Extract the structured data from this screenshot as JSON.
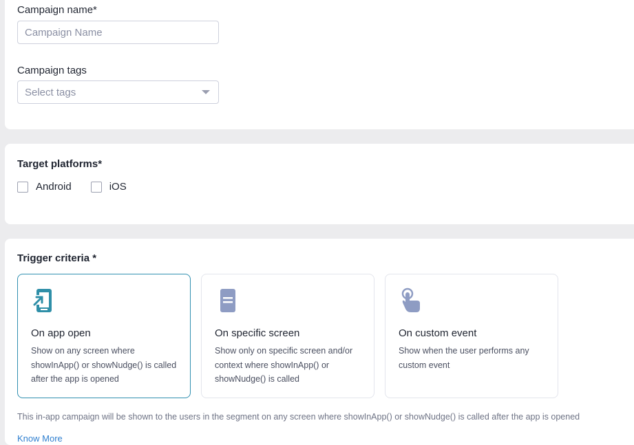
{
  "campaign_name": {
    "label": "Campaign name*",
    "placeholder": "Campaign Name",
    "value": ""
  },
  "campaign_tags": {
    "label": "Campaign tags",
    "placeholder": "Select tags"
  },
  "platforms": {
    "label": "Target platforms*",
    "options": [
      {
        "label": "Android",
        "checked": false
      },
      {
        "label": "iOS",
        "checked": false
      }
    ]
  },
  "trigger": {
    "label": "Trigger criteria *",
    "options": [
      {
        "title": "On app open",
        "description": "Show on any screen where showInApp() or showNudge() is called after the app is opened",
        "icon": "app-open-icon",
        "selected": true,
        "icon_color": "#2f8fa8"
      },
      {
        "title": "On specific screen",
        "description": "Show only on specific screen and/or context where showInApp() or showNudge() is called",
        "icon": "screen-icon",
        "selected": false,
        "icon_color": "#8e9cc3"
      },
      {
        "title": "On custom event",
        "description": "Show when the user performs any custom event",
        "icon": "tap-icon",
        "selected": false,
        "icon_color": "#8e9cc3"
      }
    ],
    "note": "This in-app campaign will be shown to the users in the segment on any screen where showInApp() or showNudge() is called after the app is opened",
    "link": "Know More"
  },
  "colors": {
    "selected_border": "#2f8fb0",
    "link": "#2f7fcf",
    "page_background": "#ececee"
  }
}
